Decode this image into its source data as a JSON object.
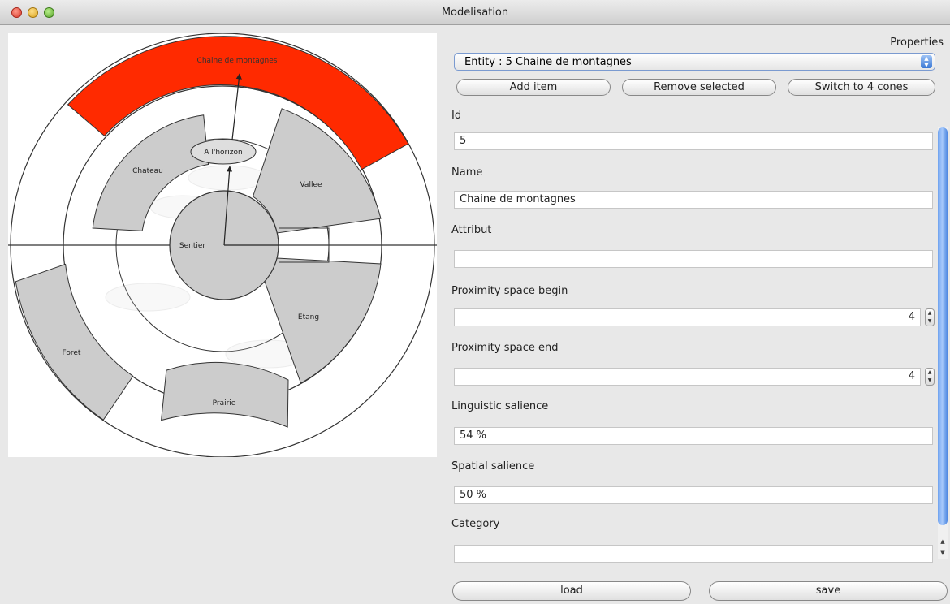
{
  "window": {
    "title": "Modelisation"
  },
  "diagram": {
    "sectors": {
      "mountains": "Chaine de montagnes",
      "valley": "Vallee",
      "castle": "Chateau",
      "pond": "Etang",
      "forest": "Foret",
      "meadow": "Prairie"
    },
    "center": "Sentier",
    "horizon": "A l'horizon",
    "selected_color": "#ff2a00",
    "sector_color": "#cccccc"
  },
  "properties": {
    "title": "Properties",
    "entity_select": "Entity : 5 Chaine de montagnes",
    "buttons": {
      "add": "Add item",
      "remove": "Remove selected",
      "switch": "Switch to 4 cones"
    },
    "fields": {
      "id": {
        "label": "Id",
        "value": "5"
      },
      "name": {
        "label": "Name",
        "value": "Chaine de montagnes"
      },
      "attribut": {
        "label": "Attribut",
        "value": ""
      },
      "prox_begin": {
        "label": "Proximity space begin",
        "value": "4"
      },
      "prox_end": {
        "label": "Proximity space end",
        "value": "4"
      },
      "ling_sal": {
        "label": "Linguistic salience",
        "value": "54 %"
      },
      "spat_sal": {
        "label": "Spatial salience",
        "value": "50 %"
      },
      "category": {
        "label": "Category",
        "value": ""
      }
    }
  },
  "footer": {
    "load": "load",
    "save": "save"
  }
}
